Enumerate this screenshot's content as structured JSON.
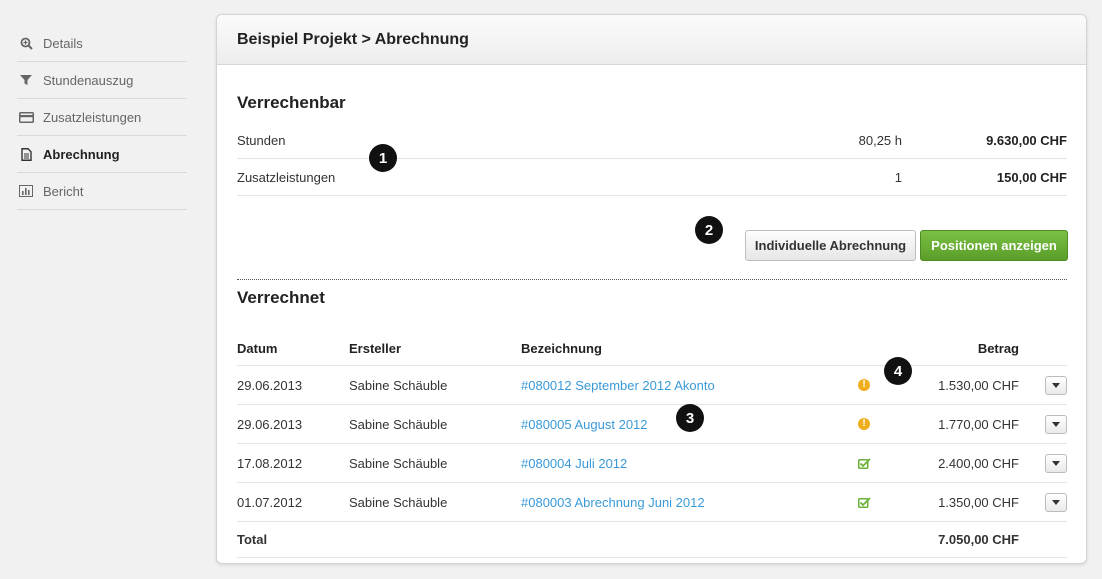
{
  "sidebar": {
    "items": [
      {
        "label": "Details",
        "icon": "zoom-icon"
      },
      {
        "label": "Stundenauszug",
        "icon": "filter-icon"
      },
      {
        "label": "Zusatzleistungen",
        "icon": "card-icon"
      },
      {
        "label": "Abrechnung",
        "icon": "document-icon",
        "active": true
      },
      {
        "label": "Bericht",
        "icon": "bar-chart-icon"
      }
    ]
  },
  "header": {
    "title": "Beispiel Projekt > Abrechnung"
  },
  "billable": {
    "title": "Verrechenbar",
    "rows": [
      {
        "label": "Stunden",
        "qty": "80,25 h",
        "amount": "9.630,00 CHF"
      },
      {
        "label": "Zusatzleistungen",
        "qty": "1",
        "amount": "150,00 CHF"
      }
    ],
    "btn_individual": "Individuelle Abrechnung",
    "btn_positions": "Positionen anzeigen"
  },
  "billed": {
    "title": "Verrechnet",
    "columns": {
      "date": "Datum",
      "creator": "Ersteller",
      "description": "Bezeichnung",
      "amount": "Betrag"
    },
    "rows": [
      {
        "date": "29.06.2013",
        "creator": "Sabine Schäuble",
        "description": "#080012 September 2012 Akonto",
        "status": "warning",
        "amount": "1.530,00 CHF"
      },
      {
        "date": "29.06.2013",
        "creator": "Sabine Schäuble",
        "description": "#080005 August 2012",
        "status": "warning",
        "amount": "1.770,00 CHF"
      },
      {
        "date": "17.08.2012",
        "creator": "Sabine Schäuble",
        "description": "#080004 Juli 2012",
        "status": "checked",
        "amount": "2.400,00 CHF"
      },
      {
        "date": "01.07.2012",
        "creator": "Sabine Schäuble",
        "description": "#080003 Abrechnung Juni 2012",
        "status": "checked",
        "amount": "1.350,00 CHF"
      }
    ],
    "total_label": "Total",
    "total_amount": "7.050,00 CHF"
  },
  "callouts": [
    "1",
    "2",
    "3",
    "4"
  ],
  "colors": {
    "accent_green": "#6ab136",
    "link_blue": "#3a9ad9",
    "warning": "#f0ad1c",
    "check_green": "#6ab136"
  }
}
